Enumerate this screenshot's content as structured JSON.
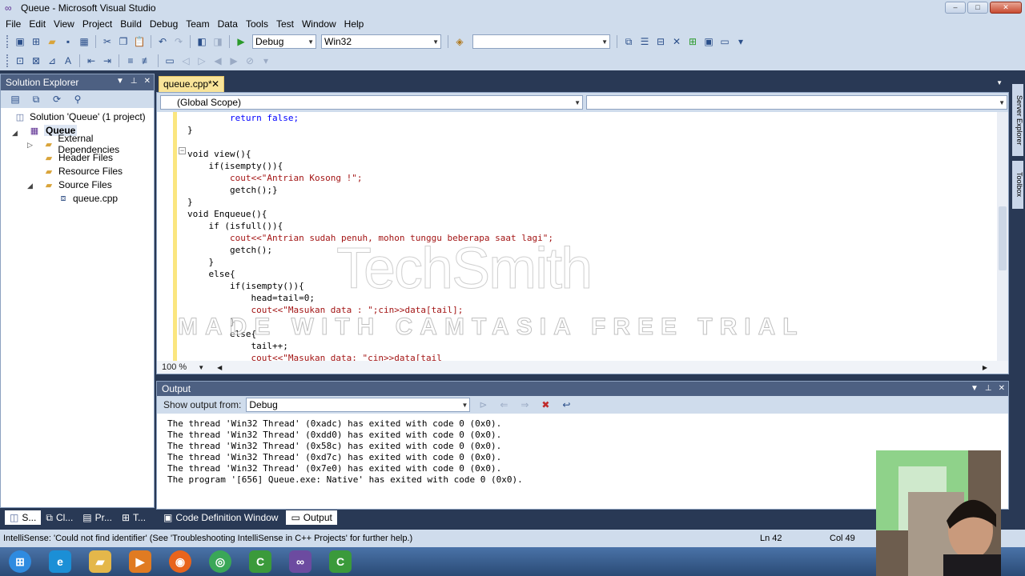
{
  "window": {
    "title": "Queue - Microsoft Visual Studio",
    "buttons": [
      "–",
      "□",
      "✕"
    ]
  },
  "menu": [
    "File",
    "Edit",
    "View",
    "Project",
    "Build",
    "Debug",
    "Team",
    "Data",
    "Tools",
    "Test",
    "Window",
    "Help"
  ],
  "toolbar": {
    "config": "Debug",
    "platform": "Win32",
    "find_value": ""
  },
  "solution_explorer": {
    "title": "Solution Explorer",
    "items": [
      {
        "label": "Solution 'Queue' (1 project)",
        "icon": "solution-icon"
      },
      {
        "label": "Queue",
        "icon": "project-icon"
      },
      {
        "label": "External Dependencies",
        "icon": "folder-icon"
      },
      {
        "label": "Header Files",
        "icon": "folder-icon"
      },
      {
        "label": "Resource Files",
        "icon": "folder-icon"
      },
      {
        "label": "Source Files",
        "icon": "folder-icon"
      },
      {
        "label": "queue.cpp",
        "icon": "cpp-file-icon"
      }
    ]
  },
  "editor": {
    "tab_label": "queue.cpp*",
    "scope": "(Global Scope)",
    "zoom": "100 %",
    "lines": [
      "        return false;",
      "}",
      "",
      "void view(){",
      "    if(isempty()){",
      "        cout<<\"Antrian Kosong !\";",
      "        getch();}",
      "}",
      "void Enqueue(){",
      "    if (isfull()){",
      "        cout<<\"Antrian sudah penuh, mohon tunggu beberapa saat lagi\";",
      "        getch();",
      "    }",
      "    else{",
      "        if(isempty()){",
      "            head=tail=0;",
      "            cout<<\"Masukan data : \";cin>>data[tail];",
      "        }",
      "        else{",
      "            tail++;",
      "            cout<<\"Masukan data: \"cin>>data[tail"
    ]
  },
  "output": {
    "title": "Output",
    "show_from_label": "Show output from:",
    "source": "Debug",
    "lines": [
      "The thread 'Win32 Thread' (0xadc) has exited with code 0 (0x0).",
      "The thread 'Win32 Thread' (0xdd0) has exited with code 0 (0x0).",
      "The thread 'Win32 Thread' (0x58c) has exited with code 0 (0x0).",
      "The thread 'Win32 Thread' (0xd7c) has exited with code 0 (0x0).",
      "The thread 'Win32 Thread' (0x7e0) has exited with code 0 (0x0).",
      "The program '[656] Queue.exe: Native' has exited with code 0 (0x0)."
    ]
  },
  "bottom_tabs": [
    "S...",
    "Cl...",
    "Pr...",
    "T...",
    "Code Definition Window",
    "Output"
  ],
  "status": {
    "message": "IntelliSense: 'Could not find identifier' (See 'Troubleshooting IntelliSense in C++ Projects' for further help.)",
    "line": "Ln 42",
    "col": "Col 49"
  },
  "side_tabs": [
    "Server Explorer",
    "Toolbox"
  ],
  "watermark": {
    "logo": "TechSmith",
    "text": "MADE WITH CAMTASIA FREE TRIAL"
  },
  "taskbar": [
    {
      "name": "start-button-icon",
      "color": "#2f8be0"
    },
    {
      "name": "internet-explorer-icon",
      "color": "#1b8fd6"
    },
    {
      "name": "file-explorer-icon",
      "color": "#e4b74a"
    },
    {
      "name": "media-player-icon",
      "color": "#e07b22"
    },
    {
      "name": "firefox-icon",
      "color": "#e8641c"
    },
    {
      "name": "chrome-icon",
      "color": "#3aa757"
    },
    {
      "name": "camtasia-icon",
      "color": "#3b9a3b"
    },
    {
      "name": "visual-studio-icon",
      "color": "#6c4ba0"
    },
    {
      "name": "camtasia-recorder-icon",
      "color": "#3b9a3b"
    }
  ]
}
